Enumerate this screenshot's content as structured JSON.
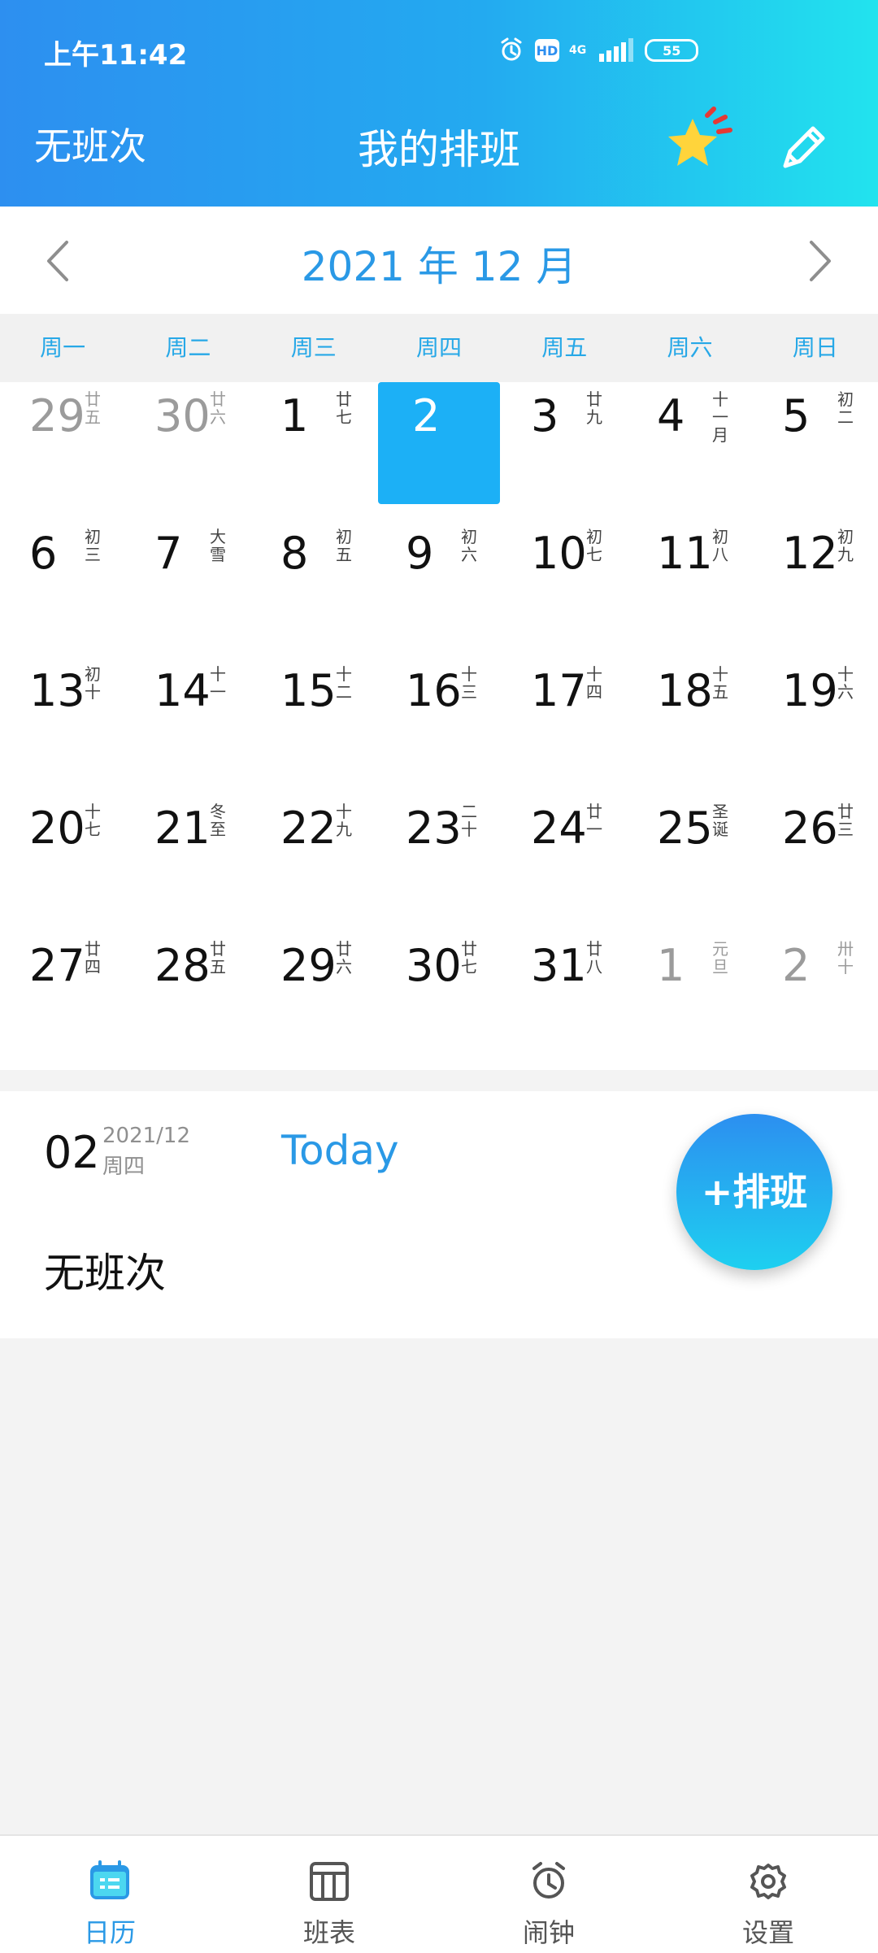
{
  "status_bar": {
    "time": "上午11:42",
    "hd": "HD",
    "network": "4G",
    "battery": "55"
  },
  "header": {
    "left_label": "无班次",
    "title": "我的排班"
  },
  "calendar": {
    "month_title": "2021 年 12 月",
    "weekdays": [
      "周一",
      "周二",
      "周三",
      "周四",
      "周五",
      "周六",
      "周日"
    ],
    "days": [
      {
        "num": "29",
        "lunar": "廿\n五",
        "muted": true
      },
      {
        "num": "30",
        "lunar": "廿\n六",
        "muted": true
      },
      {
        "num": "1",
        "lunar": "廿\n七",
        "muted": false
      },
      {
        "num": "2",
        "lunar": "",
        "muted": false,
        "selected": true
      },
      {
        "num": "3",
        "lunar": "廿\n九",
        "muted": false
      },
      {
        "num": "4",
        "lunar": "十\n一\n月",
        "muted": false
      },
      {
        "num": "5",
        "lunar": "初\n二",
        "muted": false
      },
      {
        "num": "6",
        "lunar": "初\n三",
        "muted": false
      },
      {
        "num": "7",
        "lunar": "大\n雪",
        "muted": false
      },
      {
        "num": "8",
        "lunar": "初\n五",
        "muted": false
      },
      {
        "num": "9",
        "lunar": "初\n六",
        "muted": false
      },
      {
        "num": "10",
        "lunar": "初\n七",
        "muted": false
      },
      {
        "num": "11",
        "lunar": "初\n八",
        "muted": false
      },
      {
        "num": "12",
        "lunar": "初\n九",
        "muted": false
      },
      {
        "num": "13",
        "lunar": "初\n十",
        "muted": false
      },
      {
        "num": "14",
        "lunar": "十\n一",
        "muted": false
      },
      {
        "num": "15",
        "lunar": "十\n二",
        "muted": false
      },
      {
        "num": "16",
        "lunar": "十\n三",
        "muted": false
      },
      {
        "num": "17",
        "lunar": "十\n四",
        "muted": false
      },
      {
        "num": "18",
        "lunar": "十\n五",
        "muted": false
      },
      {
        "num": "19",
        "lunar": "十\n六",
        "muted": false
      },
      {
        "num": "20",
        "lunar": "十\n七",
        "muted": false
      },
      {
        "num": "21",
        "lunar": "冬\n至",
        "muted": false
      },
      {
        "num": "22",
        "lunar": "十\n九",
        "muted": false
      },
      {
        "num": "23",
        "lunar": "二\n十",
        "muted": false
      },
      {
        "num": "24",
        "lunar": "廿\n一",
        "muted": false
      },
      {
        "num": "25",
        "lunar": "圣\n诞",
        "muted": false
      },
      {
        "num": "26",
        "lunar": "廿\n三",
        "muted": false
      },
      {
        "num": "27",
        "lunar": "廿\n四",
        "muted": false
      },
      {
        "num": "28",
        "lunar": "廿\n五",
        "muted": false
      },
      {
        "num": "29",
        "lunar": "廿\n六",
        "muted": false
      },
      {
        "num": "30",
        "lunar": "廿\n七",
        "muted": false
      },
      {
        "num": "31",
        "lunar": "廿\n八",
        "muted": false
      },
      {
        "num": "1",
        "lunar": "元\n旦",
        "muted": true
      },
      {
        "num": "2",
        "lunar": "卅\n十",
        "muted": true
      }
    ]
  },
  "detail": {
    "day": "02",
    "month": "2021/12",
    "weekday": "周四",
    "today_label": "Today",
    "status": "无班次"
  },
  "fab": {
    "label": "+排班"
  },
  "bottom_nav": [
    {
      "label": "日历",
      "active": true,
      "icon": "calendar-icon"
    },
    {
      "label": "班表",
      "active": false,
      "icon": "table-icon"
    },
    {
      "label": "闹钟",
      "active": false,
      "icon": "alarm-icon"
    },
    {
      "label": "设置",
      "active": false,
      "icon": "settings-icon"
    }
  ],
  "colors": {
    "accent": "#2a99e6",
    "header_start": "#2d8ff0",
    "header_end": "#22e3ee",
    "selected": "#1cb0f6"
  }
}
